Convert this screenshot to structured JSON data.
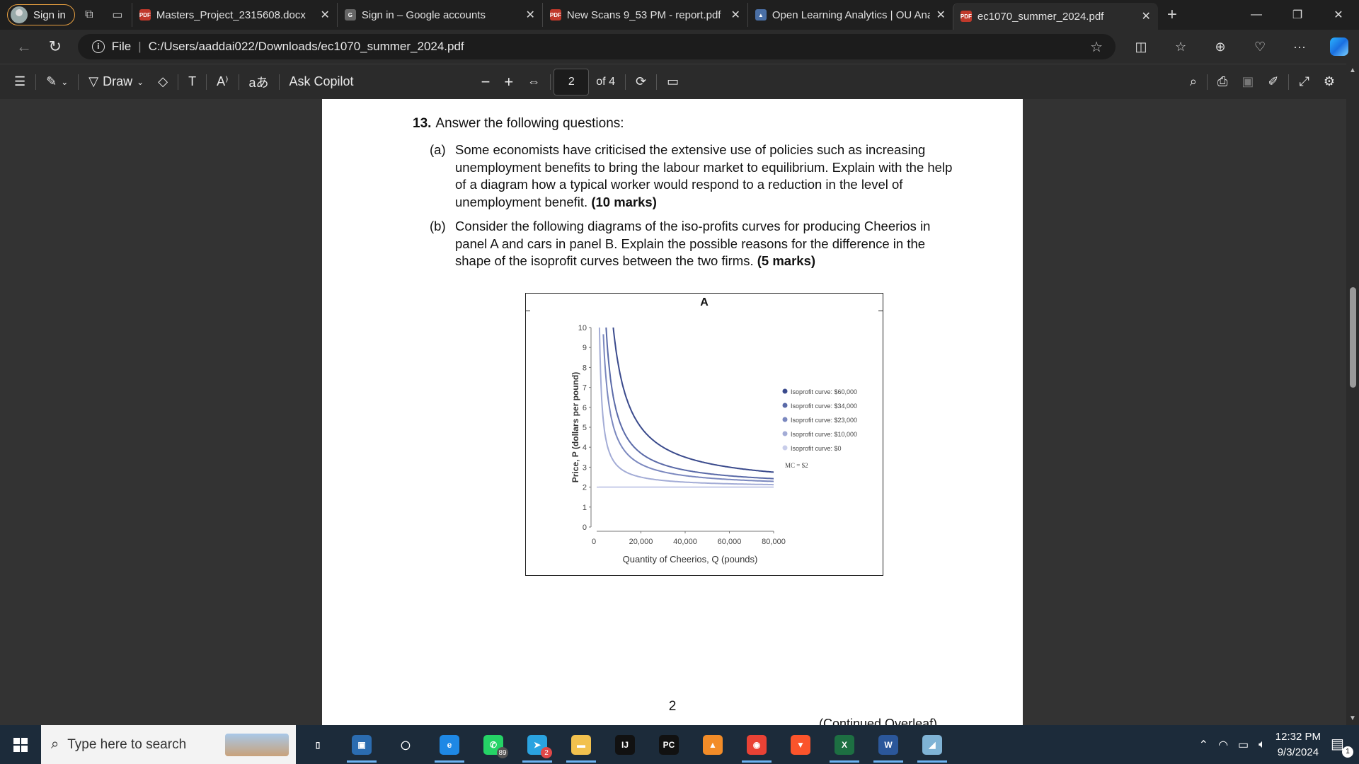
{
  "browser": {
    "sign_in_label": "Sign in",
    "tabs": [
      {
        "title": "Masters_Project_2315608.docx",
        "fav_color": "#c0392b",
        "fav_text": "PDF",
        "close": "✕"
      },
      {
        "title": "Sign in – Google accounts",
        "fav_color": "#666666",
        "fav_text": "G",
        "close": "✕"
      },
      {
        "title": "New Scans 9_53 PM - report.pdf",
        "fav_color": "#c0392b",
        "fav_text": "PDF",
        "close": "✕"
      },
      {
        "title": "Open Learning Analytics | OU Analyse",
        "fav_color": "#4a6fa5",
        "fav_text": "▲",
        "close": "✕"
      },
      {
        "title": "ec1070_summer_2024.pdf",
        "fav_color": "#c0392b",
        "fav_text": "PDF",
        "close": "✕"
      }
    ],
    "new_tab": "+",
    "address": {
      "scheme": "File",
      "path": "C:/Users/aaddai022/Downloads/ec1070_summer_2024.pdf"
    }
  },
  "pdf_toolbar": {
    "draw_label": "Draw",
    "ask_copilot": "Ask Copilot",
    "zoom_out": "−",
    "zoom_in": "+",
    "page_current": "2",
    "page_total": "of 4"
  },
  "document": {
    "question_number": "13.",
    "question_text": "Answer the following questions:",
    "parts": [
      {
        "label": "(a)",
        "text": "Some economists have criticised the extensive use of policies such as increasing unemployment benefits to bring the labour market to equilibrium. Explain with the help of a diagram how a typical worker would respond to a reduction in the level of unemployment benefit.",
        "marks": "(10 marks)"
      },
      {
        "label": "(b)",
        "text": "Consider the following diagrams of the iso-profits curves for producing Cheerios in panel A and cars in panel B. Explain the possible reasons for the difference in the shape of the isoprofit curves between the two firms.",
        "marks": "(5 marks)"
      }
    ],
    "page_number": "2",
    "continued": "(Continued Overleaf)"
  },
  "chart_data": {
    "type": "line",
    "title": "A",
    "xlabel": "Quantity of Cheerios, Q (pounds)",
    "ylabel": "Price, P (dollars per pound)",
    "xlim": [
      0,
      80000
    ],
    "ylim": [
      0,
      10
    ],
    "x_ticks": [
      "0",
      "20,000",
      "40,000",
      "60,000",
      "80,000"
    ],
    "y_ticks": [
      "0",
      "1",
      "2",
      "3",
      "4",
      "5",
      "6",
      "7",
      "8",
      "9",
      "10"
    ],
    "marginal_cost": 2,
    "mc_label": "MC = $2",
    "legend_position": "right",
    "series": [
      {
        "name": "Isoprofit curve: $60,000",
        "profit": 60000,
        "color": "#3a4a8c"
      },
      {
        "name": "Isoprofit curve: $34,000",
        "profit": 34000,
        "color": "#5a6aa8"
      },
      {
        "name": "Isoprofit curve: $23,000",
        "profit": 23000,
        "color": "#7b88bf"
      },
      {
        "name": "Isoprofit curve: $10,000",
        "profit": 10000,
        "color": "#a3acd6"
      },
      {
        "name": "Isoprofit curve: $0",
        "profit": 0,
        "color": "#c8cdea"
      }
    ]
  },
  "taskbar": {
    "search_placeholder": "Type here to search",
    "apps": [
      {
        "name": "task-view",
        "color": "transparent",
        "text": "▯",
        "badge": ""
      },
      {
        "name": "photos",
        "color": "#2b6cb0",
        "text": "▣",
        "badge": ""
      },
      {
        "name": "circle-app",
        "color": "transparent",
        "text": "◯",
        "badge": ""
      },
      {
        "name": "edge",
        "color": "#1e88e5",
        "text": "e",
        "badge": ""
      },
      {
        "name": "whatsapp",
        "color": "#25d366",
        "text": "✆",
        "badge": "89"
      },
      {
        "name": "telegram",
        "color": "#2aa3e0",
        "text": "➤",
        "badge": "2"
      },
      {
        "name": "file-explorer",
        "color": "#f2c14e",
        "text": "▬",
        "badge": ""
      },
      {
        "name": "intellij",
        "color": "#111111",
        "text": "IJ",
        "badge": ""
      },
      {
        "name": "pycharm",
        "color": "#111111",
        "text": "PC",
        "badge": ""
      },
      {
        "name": "vlc",
        "color": "#f28c28",
        "text": "▲",
        "badge": ""
      },
      {
        "name": "chrome",
        "color": "#e94235",
        "text": "◉",
        "badge": ""
      },
      {
        "name": "brave",
        "color": "#fb542b",
        "text": "▼",
        "badge": ""
      },
      {
        "name": "excel",
        "color": "#1d6f42",
        "text": "X",
        "badge": ""
      },
      {
        "name": "word",
        "color": "#2b579a",
        "text": "W",
        "badge": ""
      },
      {
        "name": "notes",
        "color": "#7fb3d5",
        "text": "◢",
        "badge": ""
      }
    ],
    "time": "12:32 PM",
    "date": "9/3/2024",
    "notification_count": "1"
  }
}
